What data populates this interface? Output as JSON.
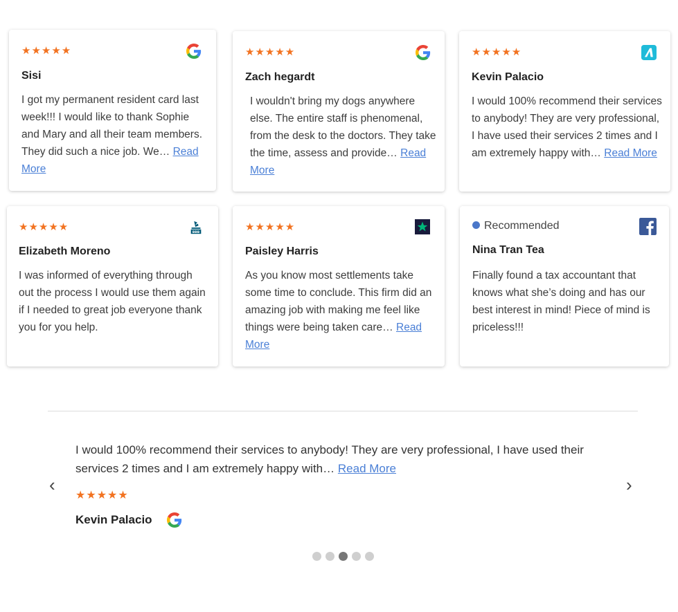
{
  "cards": [
    {
      "stars": "★★★★★",
      "name": "Sisi",
      "text": "I got my permanent resident card last week!!! I would like to thank Sophie and Mary and all their team members. They did such a nice job. We…",
      "more": "Read More",
      "source_icon": "google-icon"
    },
    {
      "stars": "★★★★★",
      "name": "Zach hegardt",
      "text": "I wouldn't bring my dogs anywhere else. The entire staff is phenomenal, from the desk to the doctors. They take the time, assess and provide…",
      "more": "Read More",
      "source_icon": "google-icon"
    },
    {
      "stars": "★★★★★",
      "name": "Kevin Palacio",
      "text": "I would 100% recommend their services to anybody! They are very professional, I have used their services 2 times and I am extremely happy with…",
      "more": "Read More",
      "source_icon": "a-logo-icon"
    },
    {
      "stars": "★★★★★",
      "name": "Elizabeth Moreno",
      "text": "I was informed of everything through out the process I would use them again if I needed to great job everyone thank you for you help.",
      "source_icon": "bbb-icon"
    },
    {
      "stars": "★★★★★",
      "name": "Paisley Harris",
      "text": "As you know most settlements take some time to conclude. This firm did an amazing job with making me feel like things were being taken care…",
      "more": "Read More",
      "source_icon": "trustpilot-icon"
    },
    {
      "recommended": "Recommended",
      "name": "Nina Tran Tea",
      "text": "Finally found a tax accountant that knows what she’s doing and has our best interest in mind! Piece of mind is priceless!!!",
      "source_icon": "facebook-icon"
    }
  ],
  "slider": {
    "text": "I would 100% recommend their services to anybody! They are very professional, I have used their services 2 times and I am extremely happy with…",
    "more": "Read More",
    "stars": "★★★★★",
    "name": "Kevin Palacio",
    "source_icon": "google-icon",
    "prev": "‹",
    "next": "›",
    "dot_count": 5,
    "active_dot": 3
  },
  "colors": {
    "star": "#f27321",
    "link": "#4a7fd6",
    "facebook": "#3b5998",
    "trustpilot_bg": "#191b3c",
    "trustpilot_star": "#00b67a",
    "a_logo": "#1fbbd9",
    "bbb": "#005a78"
  }
}
